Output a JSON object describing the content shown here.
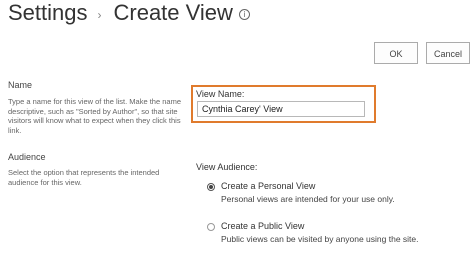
{
  "header": {
    "crumb": "Settings",
    "separator": "›",
    "title": "Create View",
    "info_glyph": "i"
  },
  "toolbar": {
    "ok_label": "OK",
    "cancel_label": "Cancel"
  },
  "name_section": {
    "title": "Name",
    "description": "Type a name for this view of the list. Make the name descriptive, such as \"Sorted by Author\", so that site visitors will know what to expect when they click this link.",
    "field_label": "View Name:",
    "field_value": "Cynthia Carey' View",
    "highlight_color": "#e07b2d"
  },
  "audience_section": {
    "title": "Audience",
    "description": "Select the option that represents the intended audience for this view.",
    "field_label": "View Audience:",
    "options": [
      {
        "label": "Create a Personal View",
        "description": "Personal views are intended for your use only.",
        "selected": true
      },
      {
        "label": "Create a Public View",
        "description": "Public views can be visited by anyone using the site.",
        "selected": false
      }
    ]
  }
}
